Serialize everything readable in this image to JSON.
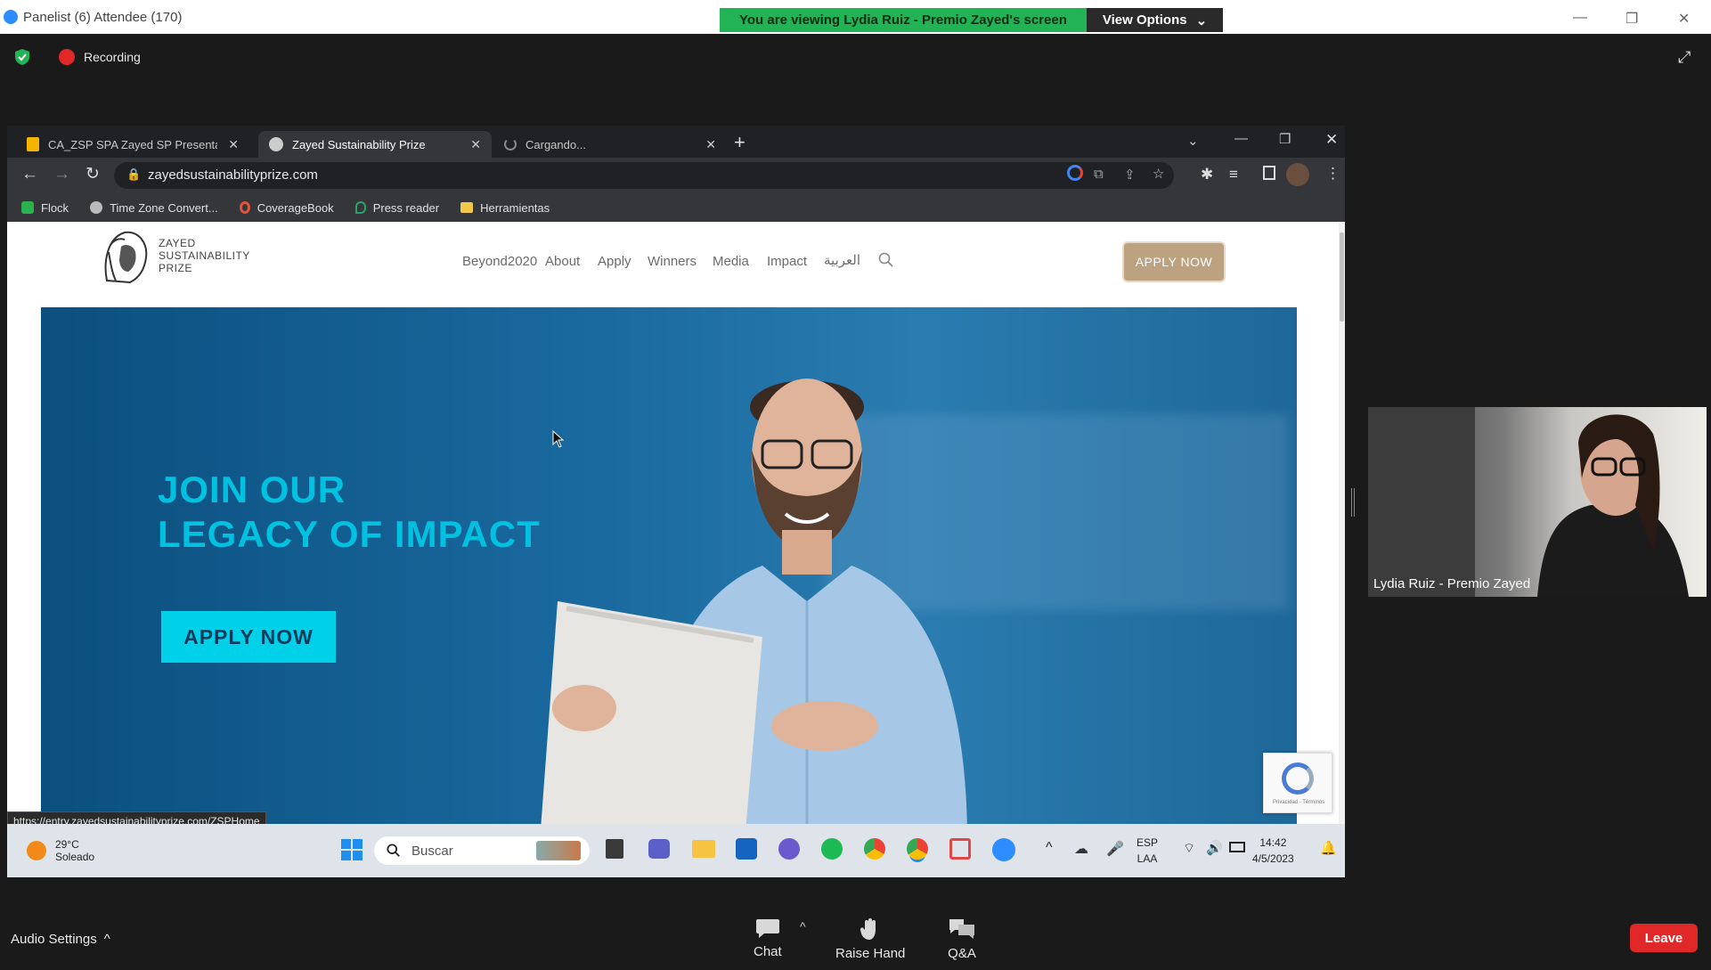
{
  "zoom": {
    "window_title": "Panelist (6) Attendee (170)",
    "share_banner": "You are viewing Lydia Ruiz - Premio Zayed's screen",
    "view_options": "View Options",
    "recording_label": "Recording",
    "toolbar": {
      "audio_settings": "Audio Settings",
      "chat": "Chat",
      "raise_hand": "Raise Hand",
      "qa": "Q&A",
      "leave": "Leave"
    },
    "participant_name": "Lydia Ruiz - Premio Zayed"
  },
  "browser": {
    "tabs": [
      {
        "label": "CA_ZSP SPA Zayed SP Presentati",
        "icon": "slides-icon"
      },
      {
        "label": "Zayed Sustainability Prize",
        "icon": "site-icon"
      },
      {
        "label": "Cargando...",
        "icon": "loading-icon"
      }
    ],
    "url": "zayedsustainabilityprize.com",
    "bookmarks": [
      {
        "label": "Flock",
        "color": "#2bb24c"
      },
      {
        "label": "Time Zone Convert...",
        "color": "#bbbbbb"
      },
      {
        "label": "CoverageBook",
        "color": "#e0533c"
      },
      {
        "label": "Press reader",
        "color": "#2ca26a"
      },
      {
        "label": "Herramientas",
        "color": "#f2c84b"
      }
    ],
    "status_url": "https://entry.zayedsustainabilityprize.com/ZSPHome"
  },
  "site": {
    "logo_lines": [
      "ZAYED",
      "SUSTAINABILITY",
      "PRIZE"
    ],
    "nav": [
      "Beyond2020",
      "About",
      "Apply",
      "Winners",
      "Media",
      "Impact",
      "العربية"
    ],
    "apply_nav": "APPLY NOW",
    "hero_title_line1": "JOIN OUR",
    "hero_title_line2": "LEGACY OF IMPACT",
    "hero_apply": "APPLY NOW",
    "recaptcha_text": "Privacidad - Términos"
  },
  "taskbar": {
    "temperature": "29°C",
    "weather": "Soleado",
    "search_placeholder": "Buscar",
    "lang_line1": "ESP",
    "lang_line2": "LAA",
    "time": "14:42",
    "date": "4/5/2023"
  },
  "colors": {
    "zoom_green": "#22b356",
    "hero_blue": "#0b4f7e",
    "hero_cyan": "#00c2e0",
    "apply_tan": "#bda282",
    "leave_red": "#e02828"
  }
}
